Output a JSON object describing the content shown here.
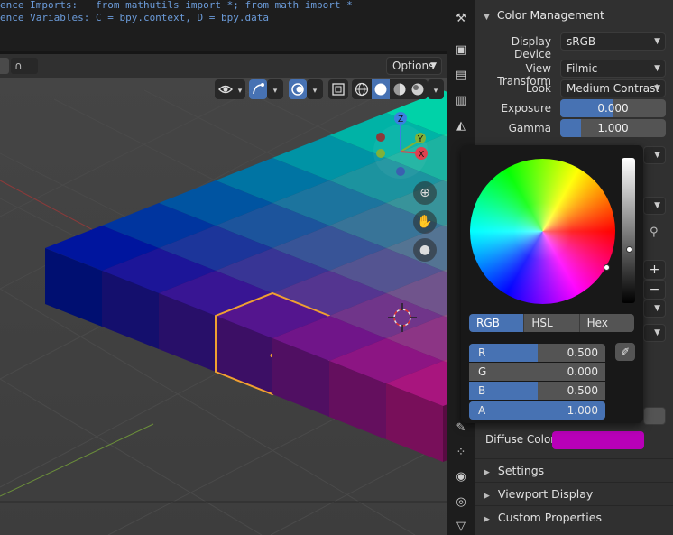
{
  "console": {
    "line1": "ence Imports:   from mathutils import *; from math import *",
    "line2": "ence Variables: C = bpy.context, D = bpy.data"
  },
  "viewport_header": {
    "options_label": "Options"
  },
  "gizmo": {
    "z_label": "Z",
    "y_label": "Y",
    "x_label": "X"
  },
  "properties": {
    "color_management": {
      "title": "Color Management",
      "display_device_label": "Display Device",
      "display_device_value": "sRGB",
      "view_transform_label": "View Transform",
      "view_transform_value": "Filmic",
      "look_label": "Look",
      "look_value": "Medium Contrast",
      "exposure_label": "Exposure",
      "exposure_value": "0.000",
      "exposure_fill": 0.5,
      "gamma_label": "Gamma",
      "gamma_value": "1.000",
      "gamma_fill": 0.2
    },
    "diffuse_color_label": "Diffuse Color",
    "diffuse_color_hex": "#b800b8",
    "collapsed_panels": [
      "Settings",
      "Viewport Display",
      "Custom Properties"
    ]
  },
  "color_picker": {
    "modes": [
      "RGB",
      "HSL",
      "Hex"
    ],
    "active_mode": "RGB",
    "components": [
      {
        "label": "R",
        "value": "0.500",
        "fill": 0.5
      },
      {
        "label": "G",
        "value": "0.000",
        "fill": 0.0
      },
      {
        "label": "B",
        "value": "0.500",
        "fill": 0.5
      },
      {
        "label": "A",
        "value": "1.000",
        "fill": 1.0
      }
    ]
  },
  "colors": {
    "accent": "#4772b3",
    "selection_outline": "#f0a030",
    "background": "#3d3d3d"
  }
}
